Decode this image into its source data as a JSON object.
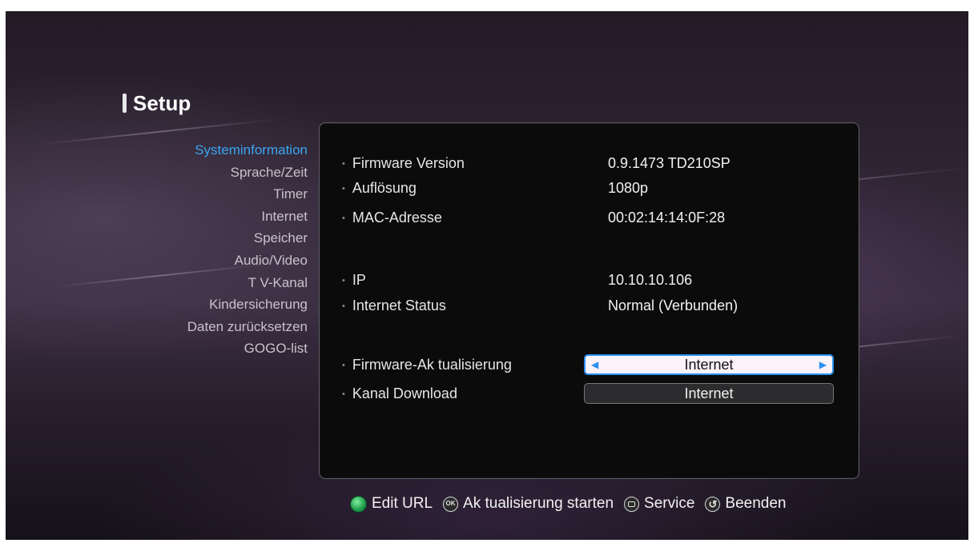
{
  "header": {
    "title": "Setup"
  },
  "menu": {
    "items": [
      {
        "label": "Systeminformation",
        "active": true
      },
      {
        "label": "Sprache/Zeit",
        "active": false
      },
      {
        "label": "Timer",
        "active": false
      },
      {
        "label": "Internet",
        "active": false
      },
      {
        "label": "Speicher",
        "active": false
      },
      {
        "label": "Audio/Video",
        "active": false
      },
      {
        "label": "T V-Kanal",
        "active": false
      },
      {
        "label": "Kindersicherung",
        "active": false
      },
      {
        "label": "Daten zurücksetzen",
        "active": false
      },
      {
        "label": "GOGO-list",
        "active": false
      }
    ]
  },
  "info": {
    "firmware_version": {
      "label": "Firmware Version",
      "value": "0.9.1473 TD210SP"
    },
    "resolution": {
      "label": "Auflösung",
      "value": "1080p"
    },
    "mac": {
      "label": "MAC-Adresse",
      "value": "00:02:14:14:0F:28"
    },
    "ip": {
      "label": "IP",
      "value": "10.10.10.106"
    },
    "internet_status": {
      "label": "Internet Status",
      "value": "Normal (Verbunden)"
    },
    "firmware_update": {
      "label": "Firmware-Ak tualisierung",
      "value": "Internet"
    },
    "channel_download": {
      "label": "Kanal Download",
      "value": "Internet"
    }
  },
  "footer": {
    "edit_url": "Edit URL",
    "ok_icon_text": "OK",
    "start_update": "Ak tualisierung starten",
    "service": "Service",
    "exit": "Beenden"
  },
  "colors": {
    "accent": "#3aa6f2",
    "focus_border": "#2a8ff0",
    "panel": "#0b0b0c"
  },
  "icons": [
    "green-button-icon",
    "ok-button-icon",
    "service-button-icon",
    "back-button-icon",
    "arrow-left-icon",
    "arrow-right-icon"
  ]
}
